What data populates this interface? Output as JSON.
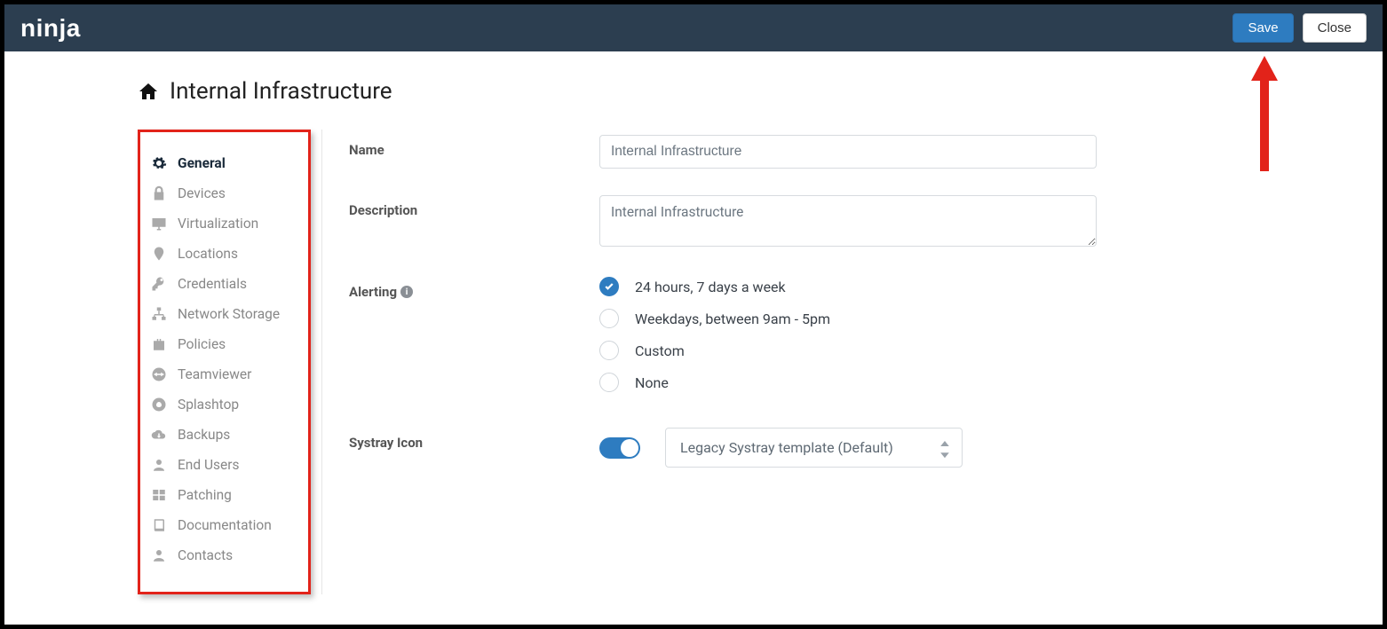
{
  "header": {
    "logo_text": "ninja",
    "save_label": "Save",
    "close_label": "Close"
  },
  "page": {
    "title": "Internal Infrastructure"
  },
  "sidebar": {
    "items": [
      {
        "label": "General",
        "icon": "gear-icon",
        "active": true
      },
      {
        "label": "Devices",
        "icon": "lock-icon"
      },
      {
        "label": "Virtualization",
        "icon": "monitor-icon"
      },
      {
        "label": "Locations",
        "icon": "pin-icon"
      },
      {
        "label": "Credentials",
        "icon": "key-icon"
      },
      {
        "label": "Network Storage",
        "icon": "network-icon"
      },
      {
        "label": "Policies",
        "icon": "briefcase-icon"
      },
      {
        "label": "Teamviewer",
        "icon": "teamviewer-icon"
      },
      {
        "label": "Splashtop",
        "icon": "splashtop-icon"
      },
      {
        "label": "Backups",
        "icon": "cloud-icon"
      },
      {
        "label": "End Users",
        "icon": "user-icon"
      },
      {
        "label": "Patching",
        "icon": "windows-icon"
      },
      {
        "label": "Documentation",
        "icon": "book-icon"
      },
      {
        "label": "Contacts",
        "icon": "user-icon"
      }
    ]
  },
  "form": {
    "name_label": "Name",
    "name_value": "Internal Infrastructure",
    "description_label": "Description",
    "description_value": "Internal Infrastructure",
    "alerting_label": "Alerting",
    "alerting_options": [
      "24 hours, 7 days a week",
      "Weekdays, between 9am - 5pm",
      "Custom",
      "None"
    ],
    "alerting_selected_index": 0,
    "systray_label": "Systray Icon",
    "systray_toggle": true,
    "systray_select_value": "Legacy Systray template (Default)"
  },
  "colors": {
    "primary": "#2e7cc0",
    "header_bg": "#2c3e50",
    "annotation": "#e2231a"
  }
}
